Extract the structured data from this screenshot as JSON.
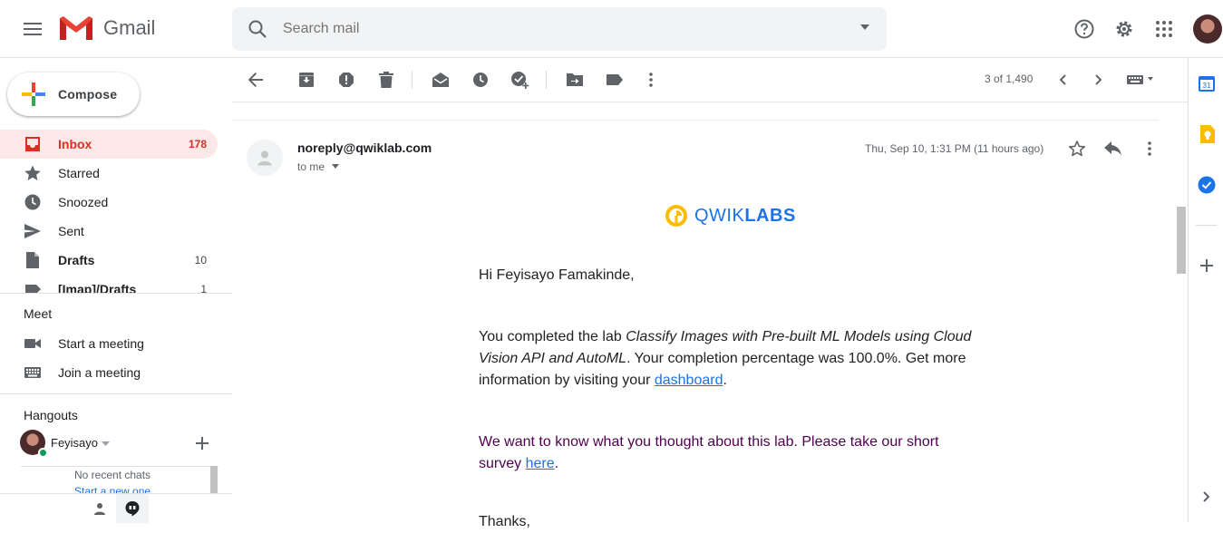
{
  "app": {
    "name": "Gmail"
  },
  "search": {
    "placeholder": "Search mail"
  },
  "compose": {
    "label": "Compose"
  },
  "nav": [
    {
      "label": "Inbox",
      "count": "178",
      "icon": "inbox-icon"
    },
    {
      "label": "Starred",
      "count": "",
      "icon": "star-icon"
    },
    {
      "label": "Snoozed",
      "count": "",
      "icon": "clock-icon"
    },
    {
      "label": "Sent",
      "count": "",
      "icon": "send-icon"
    },
    {
      "label": "Drafts",
      "count": "10",
      "icon": "draft-icon"
    },
    {
      "label": "[Imap]/Drafts",
      "count": "1",
      "icon": "label-icon"
    }
  ],
  "meet": {
    "title": "Meet",
    "start": "Start a meeting",
    "join": "Join a meeting"
  },
  "hangouts": {
    "title": "Hangouts",
    "user": "Feyisayo",
    "no_chats": "No recent chats",
    "start_new": "Start a new one"
  },
  "toolbar": {
    "pager": "3 of 1,490"
  },
  "message": {
    "sender": "noreply@qwiklab.com",
    "to": "to me",
    "date": "Thu, Sep 10, 1:31 PM (11 hours ago)",
    "brand_light": "QWIK",
    "brand_bold": "LABS",
    "greeting": "Hi Feyisayo Famakinde,",
    "p1_start": "You completed the lab ",
    "p1_lab": "Classify Images with Pre-built ML Models using Cloud Vision API and AutoML",
    "p1_mid": ". Your completion percentage was 100.0%. Get more information by visiting your ",
    "p1_link": "dashboard",
    "p1_end": ".",
    "p2_start": "We want to know what you thought about this lab. Please take our short survey ",
    "p2_link": "here",
    "p2_end": ".",
    "p3": "Thanks,"
  },
  "colors": {
    "inbox_active_bg": "#fce8e6",
    "inbox_active_text": "#d93025",
    "link": "#1a73e8",
    "survey_text": "#500050"
  }
}
